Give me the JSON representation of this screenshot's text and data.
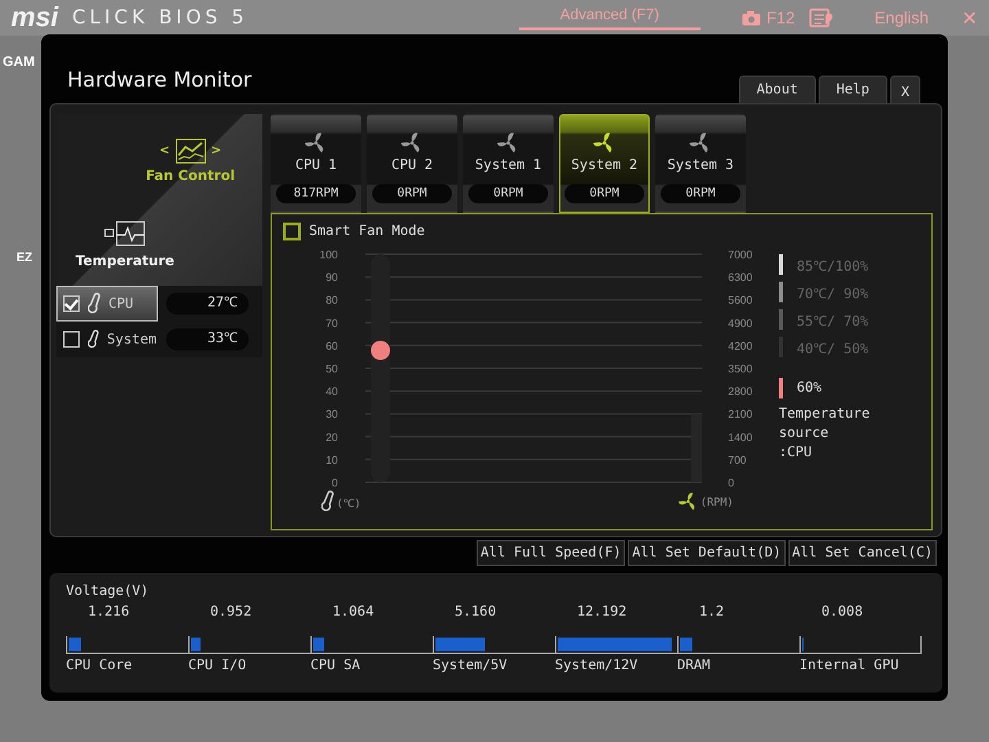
{
  "header": {
    "brand": "msi",
    "product": "CLICK BIOS 5",
    "mode": "Advanced (F7)",
    "screenshot_key": "F12",
    "language": "English",
    "close": "✕"
  },
  "background": {
    "tab_fragment": "GAM",
    "panel_fragment": "EZ"
  },
  "window": {
    "title": "Hardware Monitor",
    "buttons": [
      {
        "label": "About",
        "kind": "text"
      },
      {
        "label": "Help",
        "kind": "text"
      },
      {
        "label": "X",
        "kind": "close"
      }
    ]
  },
  "sidebar": {
    "fan_control": {
      "label": "Fan Control",
      "prev": "<",
      "next": ">"
    },
    "temperature": {
      "label": "Temperature"
    },
    "sensors": [
      {
        "label": "CPU",
        "value": "27℃",
        "checked": true,
        "selected": true
      },
      {
        "label": "System",
        "value": "33℃",
        "checked": false,
        "selected": false
      }
    ]
  },
  "fan_tabs": [
    {
      "label": "CPU 1",
      "reading": "817RPM",
      "selected": false
    },
    {
      "label": "CPU 2",
      "reading": "0RPM",
      "selected": false
    },
    {
      "label": "System 1",
      "reading": "0RPM",
      "selected": false
    },
    {
      "label": "System 2",
      "reading": "0RPM",
      "selected": true
    },
    {
      "label": "System 3",
      "reading": "0RPM",
      "selected": false
    }
  ],
  "fan_panel": {
    "smart_fan_mode": {
      "label": "Smart Fan Mode",
      "checked": false
    },
    "temp_ticks": [
      "100",
      "90",
      "80",
      "70",
      "60",
      "50",
      "40",
      "30",
      "20",
      "10",
      "0"
    ],
    "rpm_ticks": [
      "7000",
      "6300",
      "5600",
      "4900",
      "4200",
      "3500",
      "2800",
      "2100",
      "1400",
      "700",
      "0"
    ],
    "speed_marker": {
      "level": 0.58,
      "color": "#f08080"
    },
    "temp_unit": "(℃)",
    "rpm_unit": "(RPM)",
    "legend": [
      {
        "label": "85℃/100%",
        "color": "#d8d8d8"
      },
      {
        "label": "70℃/ 90%",
        "color": "#8c8c8c"
      },
      {
        "label": "55℃/ 70%",
        "color": "#5a5a5a"
      },
      {
        "label": "40℃/ 50%",
        "color": "#333333"
      }
    ],
    "current": {
      "label": "60%",
      "color": "#f08080"
    },
    "source_label": "Temperature source",
    "source_value": ":CPU"
  },
  "actions": [
    "All Full Speed(F)",
    "All Set Default(D)",
    "All Set Cancel(C)"
  ],
  "voltage": {
    "title": "Voltage(V)",
    "items": [
      {
        "label": "CPU Core",
        "value": "1.216",
        "level": 0.1
      },
      {
        "label": "CPU I/O",
        "value": "0.952",
        "level": 0.08
      },
      {
        "label": "CPU SA",
        "value": "1.064",
        "level": 0.09
      },
      {
        "label": "System/5V",
        "value": "5.160",
        "level": 0.41
      },
      {
        "label": "System/12V",
        "value": "12.192",
        "level": 0.94
      },
      {
        "label": "DRAM",
        "value": "1.2",
        "level": 0.1
      },
      {
        "label": "Internal GPU",
        "value": "0.008",
        "level": 0.01
      }
    ]
  }
}
